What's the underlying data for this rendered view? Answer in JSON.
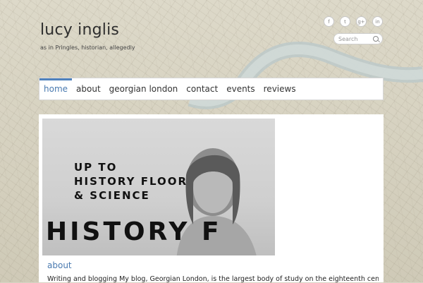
{
  "site": {
    "title": "lucy inglis",
    "tagline": "as in Pringles, historian, allegedly"
  },
  "social": [
    {
      "name": "facebook",
      "glyph": "f"
    },
    {
      "name": "twitter",
      "glyph": "t"
    },
    {
      "name": "google-plus",
      "glyph": "g+"
    },
    {
      "name": "linkedin",
      "glyph": "in"
    }
  ],
  "search": {
    "placeholder": "Search"
  },
  "nav": {
    "items": [
      {
        "label": "home",
        "active": true
      },
      {
        "label": "about"
      },
      {
        "label": "georgian london"
      },
      {
        "label": "contact"
      },
      {
        "label": "events"
      },
      {
        "label": "reviews"
      }
    ]
  },
  "photo": {
    "sign_line1": "UP TO",
    "sign_line2": "HISTORY FLOOR",
    "sign_line3": "& SCIENCE",
    "sign_line4": "HISTORY F"
  },
  "article": {
    "heading": "about",
    "text": "Writing and blogging My blog, Georgian London, is the largest body of study on the eighteenth century"
  },
  "colors": {
    "accent": "#4f81bd",
    "link": "#4a7ab0"
  }
}
